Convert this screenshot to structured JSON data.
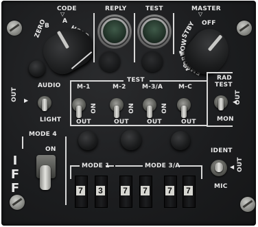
{
  "panel": {
    "designation": "IFF"
  },
  "code": {
    "label": "CODE",
    "positions": [
      "ZERO",
      "B",
      "A",
      "HOLD"
    ]
  },
  "reply": {
    "label": "REPLY"
  },
  "test": {
    "label": "TEST"
  },
  "master": {
    "label": "MASTER",
    "positions": [
      "OFF",
      "STBY",
      "LOW",
      "NORM",
      "EMER"
    ]
  },
  "audio": {
    "label": "AUDIO",
    "on": "LIGHT",
    "off": "OUT"
  },
  "mode_switches": {
    "group_label": "TEST",
    "items": [
      {
        "label": "M-1",
        "down": "OUT",
        "center": "ON"
      },
      {
        "label": "M-2",
        "down": "OUT",
        "center": "ON"
      },
      {
        "label": "M-3/A",
        "down": "OUT",
        "center": "ON"
      },
      {
        "label": "M-C",
        "down": "OUT",
        "center": ""
      }
    ]
  },
  "rad_test": {
    "label_line1": "RAD",
    "label_line2": "TEST",
    "down": "MON",
    "off": "OUT"
  },
  "mode4": {
    "label": "MODE 4",
    "on": "ON"
  },
  "ident": {
    "label": "IDENT",
    "down": "MIC",
    "off": "OUT"
  },
  "code_readout": {
    "mode1_label": "MODE 1",
    "mode3a_label": "MODE 3/A",
    "mode1_digits": [
      "7",
      "3"
    ],
    "mode3a_digits": [
      "7",
      "7",
      "7",
      "7"
    ]
  }
}
